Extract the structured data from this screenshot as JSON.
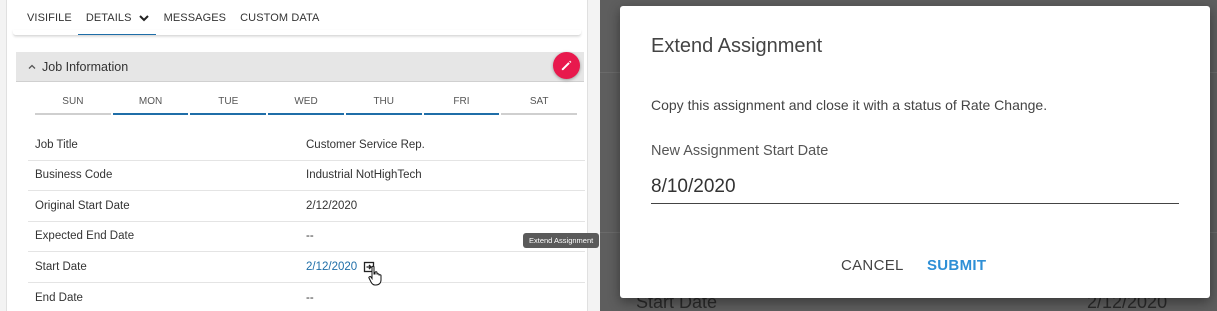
{
  "tabs": [
    {
      "label": "VISIFILE"
    },
    {
      "label": "DETAILS"
    },
    {
      "label": "MESSAGES"
    },
    {
      "label": "CUSTOM DATA"
    }
  ],
  "section": {
    "title": "Job Information"
  },
  "days": [
    "SUN",
    "MON",
    "TUE",
    "WED",
    "THU",
    "FRI",
    "SAT"
  ],
  "fields": [
    {
      "label": "Job Title",
      "value": "Customer Service Rep."
    },
    {
      "label": "Business Code",
      "value": "Industrial NotHighTech"
    },
    {
      "label": "Original Start Date",
      "value": "2/12/2020"
    },
    {
      "label": "Expected End Date",
      "value": "--"
    },
    {
      "label": "Start Date",
      "value": "2/12/2020"
    },
    {
      "label": "End Date",
      "value": "--"
    }
  ],
  "tooltip": "Extend Assignment",
  "background_peek": {
    "start_label": "Start Date",
    "start_value": "2/12/2020"
  },
  "dialog": {
    "title": "Extend Assignment",
    "message": "Copy this assignment and close it with a status of Rate Change.",
    "field_label": "New Assignment Start Date",
    "field_value": "8/10/2020",
    "cancel_label": "CANCEL",
    "submit_label": "SUBMIT"
  },
  "colors": {
    "accent": "#1f6ea8",
    "fab": "#e8194d",
    "submit": "#2e8fd6"
  }
}
